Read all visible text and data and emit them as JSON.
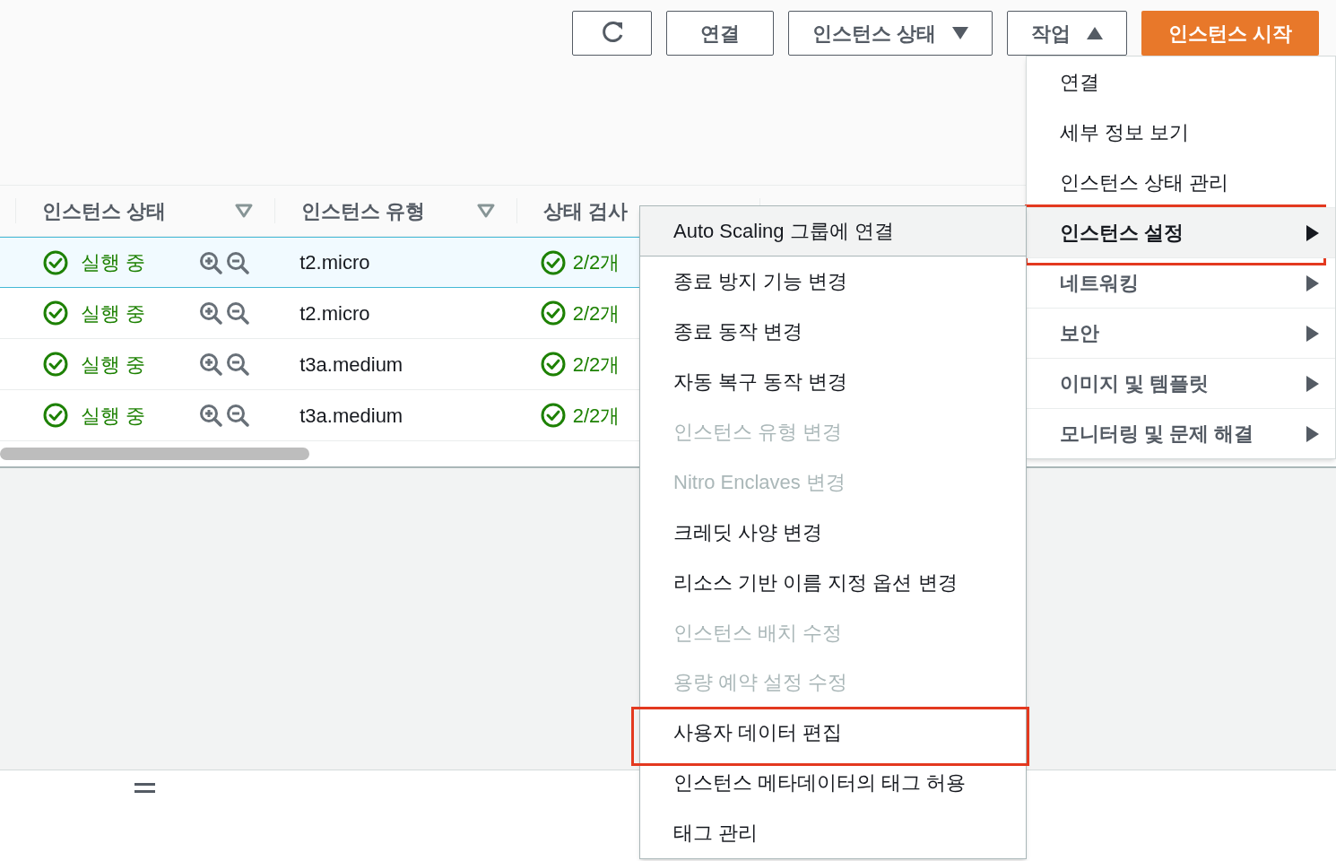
{
  "toolbar": {
    "buttons": [
      {
        "kind": "icon"
      },
      {
        "kind": "plain",
        "label": "연결"
      },
      {
        "kind": "dropdown",
        "label": "인스턴스 상태",
        "expanded": false
      },
      {
        "kind": "dropdown",
        "label": "작업",
        "expanded": true
      },
      {
        "kind": "primary",
        "label": "인스턴스 시작"
      }
    ]
  },
  "table": {
    "columns": [
      {
        "label": "인스턴스 상태",
        "filter": true
      },
      {
        "label": "인스턴스 유형",
        "filter": true
      },
      {
        "label": "상태 검사",
        "filter": false
      }
    ],
    "rows": [
      {
        "selected": true,
        "state": "실행 중",
        "type": "t2.micro",
        "check": "2/2개"
      },
      {
        "selected": false,
        "state": "실행 중",
        "type": "t2.micro",
        "check": "2/2개"
      },
      {
        "selected": false,
        "state": "실행 중",
        "type": "t3a.medium",
        "check": "2/2개"
      },
      {
        "selected": false,
        "state": "실행 중",
        "type": "t3a.medium",
        "check": "2/2개"
      }
    ]
  },
  "actions_menu": {
    "items": [
      {
        "kind": "action",
        "label": "연결",
        "selected": false,
        "highlighted": false
      },
      {
        "kind": "action",
        "label": "세부 정보 보기",
        "selected": false,
        "highlighted": false
      },
      {
        "kind": "action",
        "label": "인스턴스 상태 관리",
        "selected": false,
        "highlighted": false
      },
      {
        "kind": "submenu",
        "label": "인스턴스 설정",
        "selected": true,
        "highlighted": true
      },
      {
        "kind": "submenu",
        "label": "네트워킹",
        "selected": false,
        "highlighted": false
      },
      {
        "kind": "submenu",
        "label": "보안",
        "selected": false,
        "highlighted": false
      },
      {
        "kind": "submenu",
        "label": "이미지 및 템플릿",
        "selected": false,
        "highlighted": false
      },
      {
        "kind": "submenu",
        "label": "모니터링 및 문제 해결",
        "selected": false,
        "highlighted": false
      }
    ]
  },
  "settings_submenu": {
    "items": [
      {
        "label": "Auto Scaling 그룹에 연결",
        "disabled": false,
        "selected": true,
        "highlighted": false
      },
      {
        "label": "종료 방지 기능 변경",
        "disabled": false,
        "selected": false,
        "highlighted": false
      },
      {
        "label": "종료 동작 변경",
        "disabled": false,
        "selected": false,
        "highlighted": false
      },
      {
        "label": "자동 복구 동작 변경",
        "disabled": false,
        "selected": false,
        "highlighted": false
      },
      {
        "label": "인스턴스 유형 변경",
        "disabled": true,
        "selected": false,
        "highlighted": false
      },
      {
        "label": "Nitro Enclaves 변경",
        "disabled": true,
        "selected": false,
        "highlighted": false
      },
      {
        "label": "크레딧 사양 변경",
        "disabled": false,
        "selected": false,
        "highlighted": false
      },
      {
        "label": "리소스 기반 이름 지정 옵션 변경",
        "disabled": false,
        "selected": false,
        "highlighted": false
      },
      {
        "label": "인스턴스 배치 수정",
        "disabled": true,
        "selected": false,
        "highlighted": false
      },
      {
        "label": "용량 예약 설정 수정",
        "disabled": true,
        "selected": false,
        "highlighted": false
      },
      {
        "label": "사용자 데이터 편집",
        "disabled": false,
        "selected": false,
        "highlighted": true
      },
      {
        "label": "인스턴스 메타데이터의 태그 허용",
        "disabled": false,
        "selected": false,
        "highlighted": false
      },
      {
        "label": "태그 관리",
        "disabled": false,
        "selected": false,
        "highlighted": false
      }
    ]
  }
}
